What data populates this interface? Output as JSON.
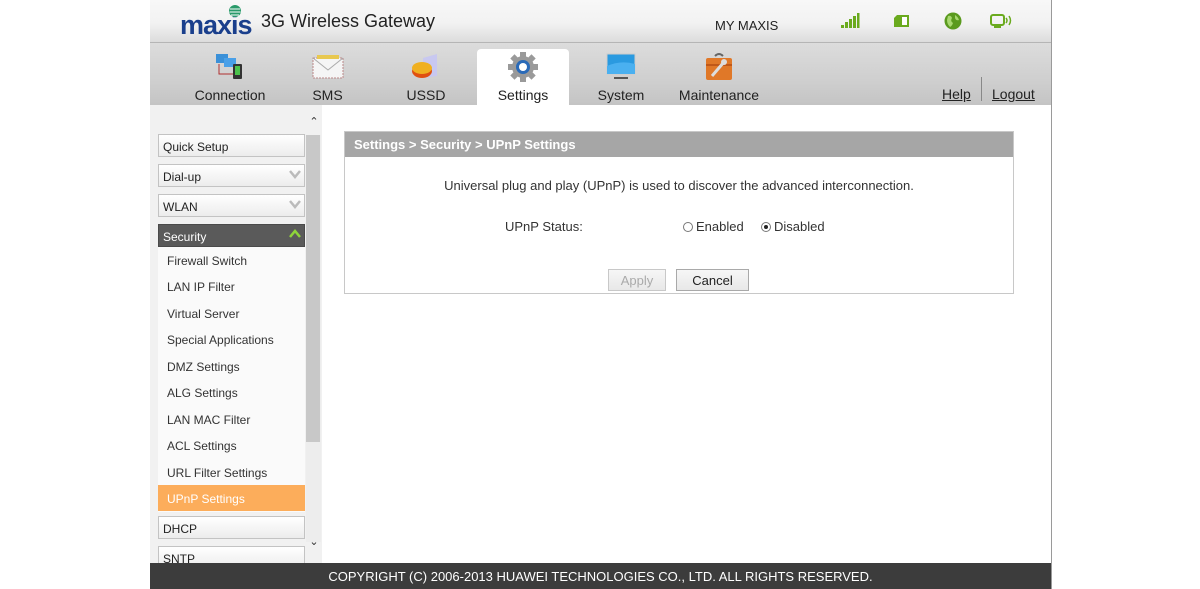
{
  "header": {
    "brand": "maxis",
    "app_title": "3G Wireless Gateway",
    "my_maxis": "MY MAXIS",
    "status_icons": [
      "signal-strength-icon",
      "sim-card-icon",
      "internet-globe-icon",
      "wlan-device-icon"
    ],
    "status_color": "#6aaa1e"
  },
  "nav": {
    "tabs": [
      {
        "label": "Connection",
        "icon": "connection-icon"
      },
      {
        "label": "SMS",
        "icon": "envelope-icon"
      },
      {
        "label": "USSD",
        "icon": "ussd-icon"
      },
      {
        "label": "Settings",
        "icon": "gear-icon",
        "active": true
      },
      {
        "label": "System",
        "icon": "monitor-icon"
      },
      {
        "label": "Maintenance",
        "icon": "toolbox-icon"
      }
    ],
    "help": "Help",
    "logout": "Logout"
  },
  "sidebar": {
    "menu": [
      {
        "label": "Quick Setup"
      },
      {
        "label": "Dial-up"
      },
      {
        "label": "WLAN"
      },
      {
        "label": "Security",
        "open": true
      },
      {
        "label": "DHCP"
      },
      {
        "label": "SNTP"
      }
    ],
    "security_items": [
      "Firewall Switch",
      "LAN IP Filter",
      "Virtual Server",
      "Special Applications",
      "DMZ Settings",
      "ALG Settings",
      "LAN MAC Filter",
      "ACL Settings",
      "URL Filter Settings",
      "UPnP Settings"
    ],
    "selected": "UPnP Settings",
    "selected_color": "#fcad5b"
  },
  "content": {
    "breadcrumb": "Settings > Security > UPnP Settings",
    "description": "Universal plug and play (UPnP) is used to discover the advanced interconnection.",
    "status_label": "UPnP Status:",
    "options": [
      "Enabled",
      "Disabled"
    ],
    "selected_option": "Disabled",
    "apply_label": "Apply",
    "cancel_label": "Cancel"
  },
  "footer": {
    "copyright": "COPYRIGHT (C) 2006-2013 HUAWEI TECHNOLOGIES CO., LTD. ALL RIGHTS RESERVED."
  }
}
